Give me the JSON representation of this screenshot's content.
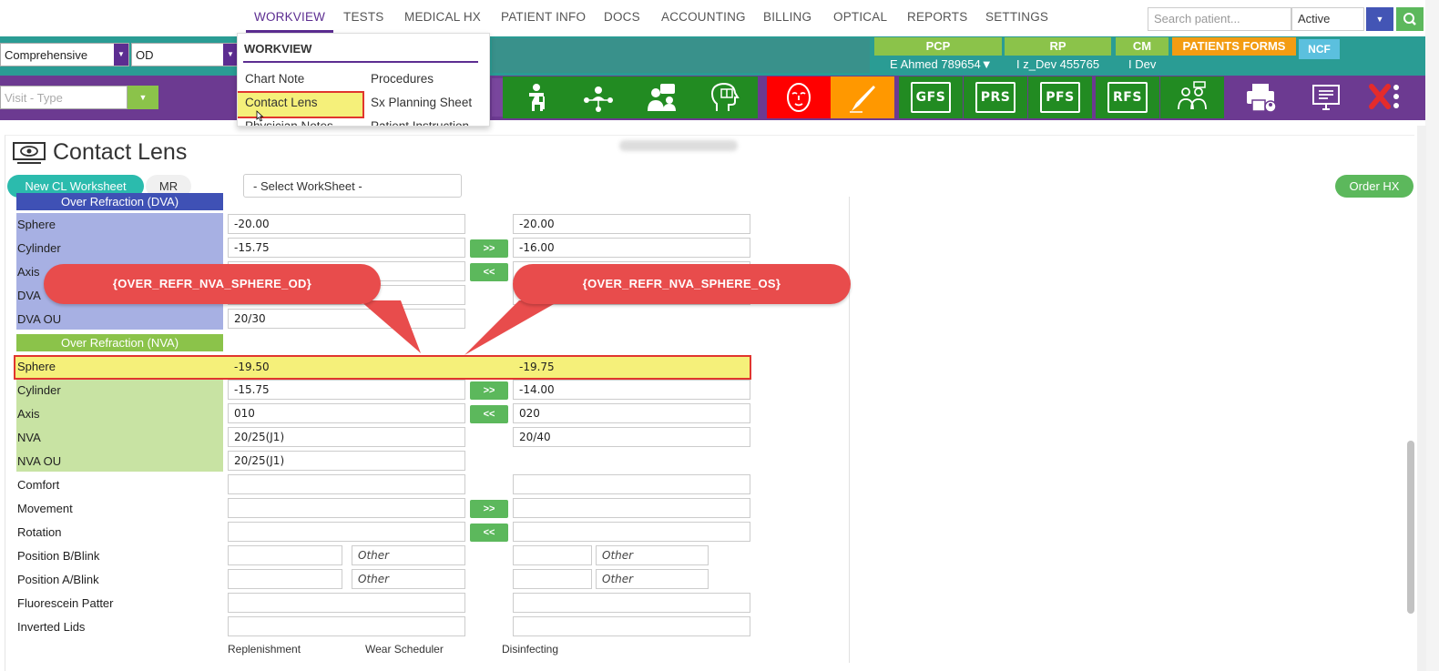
{
  "nav": {
    "items": [
      "WORKVIEW",
      "TESTS",
      "MEDICAL HX",
      "PATIENT INFO",
      "DOCS",
      "ACCOUNTING",
      "BILLING",
      "OPTICAL",
      "REPORTS",
      "SETTINGS"
    ],
    "search_placeholder": "Search patient...",
    "status_value": "Active"
  },
  "band": {
    "exam_type": "Comprehensive",
    "eye": "OD",
    "visit_type_placeholder": "Visit - Type",
    "pcp_label": "PCP",
    "rp_label": "RP",
    "cm_label": "CM",
    "patients_forms_label": "PATIENTS FORMS",
    "ncf_label": "NCF",
    "pcp_value": "E Ahmed 789654▼",
    "rp_value": "I z_Dev 455765",
    "cm_value": "I Dev",
    "colors": {
      "teal": "#2a9c94",
      "purple": "#6c3a91",
      "green": "#8bc34a",
      "orange": "#f39c12",
      "ncf_blue": "#5bc0de"
    }
  },
  "toolbar_icons": [
    {
      "name": "patient-walker-icon",
      "bg": "#228b22"
    },
    {
      "name": "network-person-icon",
      "bg": "#228b22"
    },
    {
      "name": "consult-chat-icon",
      "bg": "#228b22"
    },
    {
      "name": "head-book-icon",
      "bg": "#228b22"
    },
    {
      "name": "face-icon",
      "bg": "#ff0000"
    },
    {
      "name": "scalpel-icon",
      "bg": "#ff9800"
    },
    {
      "name": "gfs-icon",
      "label": "GFS",
      "bg": "#228b22"
    },
    {
      "name": "prs-icon",
      "label": "PRS",
      "bg": "#228b22"
    },
    {
      "name": "pfs-icon",
      "label": "PFS",
      "bg": "#228b22"
    },
    {
      "name": "rfs-icon",
      "label": "RFS",
      "bg": "#228b22"
    },
    {
      "name": "doctor-patient-icon",
      "bg": "#228b22"
    },
    {
      "name": "printer-user-icon",
      "bg": "#6c3a91"
    },
    {
      "name": "monitor-document-icon",
      "bg": "#6c3a91"
    },
    {
      "name": "close-menu-icon",
      "bg": "#6c3a91"
    }
  ],
  "dropdown": {
    "title": "WORKVIEW",
    "col1": [
      "Chart Note",
      "Contact Lens",
      "Physician Notes"
    ],
    "col2": [
      "Procedures",
      "Sx Planning Sheet",
      "Patient Instruction"
    ],
    "highlighted": "Contact Lens"
  },
  "page": {
    "title": "Contact Lens",
    "new_cl_button": "New CL Worksheet",
    "mr_button": "MR",
    "worksheet_select": "- Select WorkSheet -",
    "order_hx_button": "Order HX"
  },
  "dva_section": {
    "header": "Over Refraction (DVA)",
    "color": "#a7b0e3",
    "rows": [
      {
        "label": "Sphere",
        "od": "-20.00",
        "os": "-20.00"
      },
      {
        "label": "Cylinder",
        "od": "-15.75",
        "os": "-16.00",
        "btn": ">>"
      },
      {
        "label": "Axis",
        "od": "",
        "os": "",
        "btn": "<<"
      },
      {
        "label": "DVA",
        "od": "",
        "os": ""
      },
      {
        "label": "DVA OU",
        "od": "20/30"
      }
    ]
  },
  "nva_section": {
    "header": "Over Refraction (NVA)",
    "color": "#c8e3a3",
    "rows": [
      {
        "label": "Sphere",
        "od": "-19.50",
        "os": "-19.75"
      },
      {
        "label": "Cylinder",
        "od": "-15.75",
        "os": "-14.00",
        "btn": ">>"
      },
      {
        "label": "Axis",
        "od": "010",
        "os": "020",
        "btn": "<<"
      },
      {
        "label": "NVA",
        "od": "20/25(J1)",
        "os": "20/40"
      },
      {
        "label": "NVA OU",
        "od": "20/25(J1)"
      }
    ]
  },
  "other_rows": [
    {
      "label": "Comfort"
    },
    {
      "label": "Movement",
      "btn": ">>"
    },
    {
      "label": "Rotation",
      "btn": "<<"
    },
    {
      "label": "Position B/Blink",
      "other": "Other"
    },
    {
      "label": "Position A/Blink",
      "other": "Other"
    },
    {
      "label": "Fluorescein Patter"
    },
    {
      "label": "Inverted Lids"
    }
  ],
  "bottom_labels": [
    "Replenishment",
    "Wear Scheduler",
    "Disinfecting"
  ],
  "callouts": {
    "od": "{OVER_REFR_NVA_SPHERE_OD}",
    "os": "{OVER_REFR_NVA_SPHERE_OS}"
  }
}
